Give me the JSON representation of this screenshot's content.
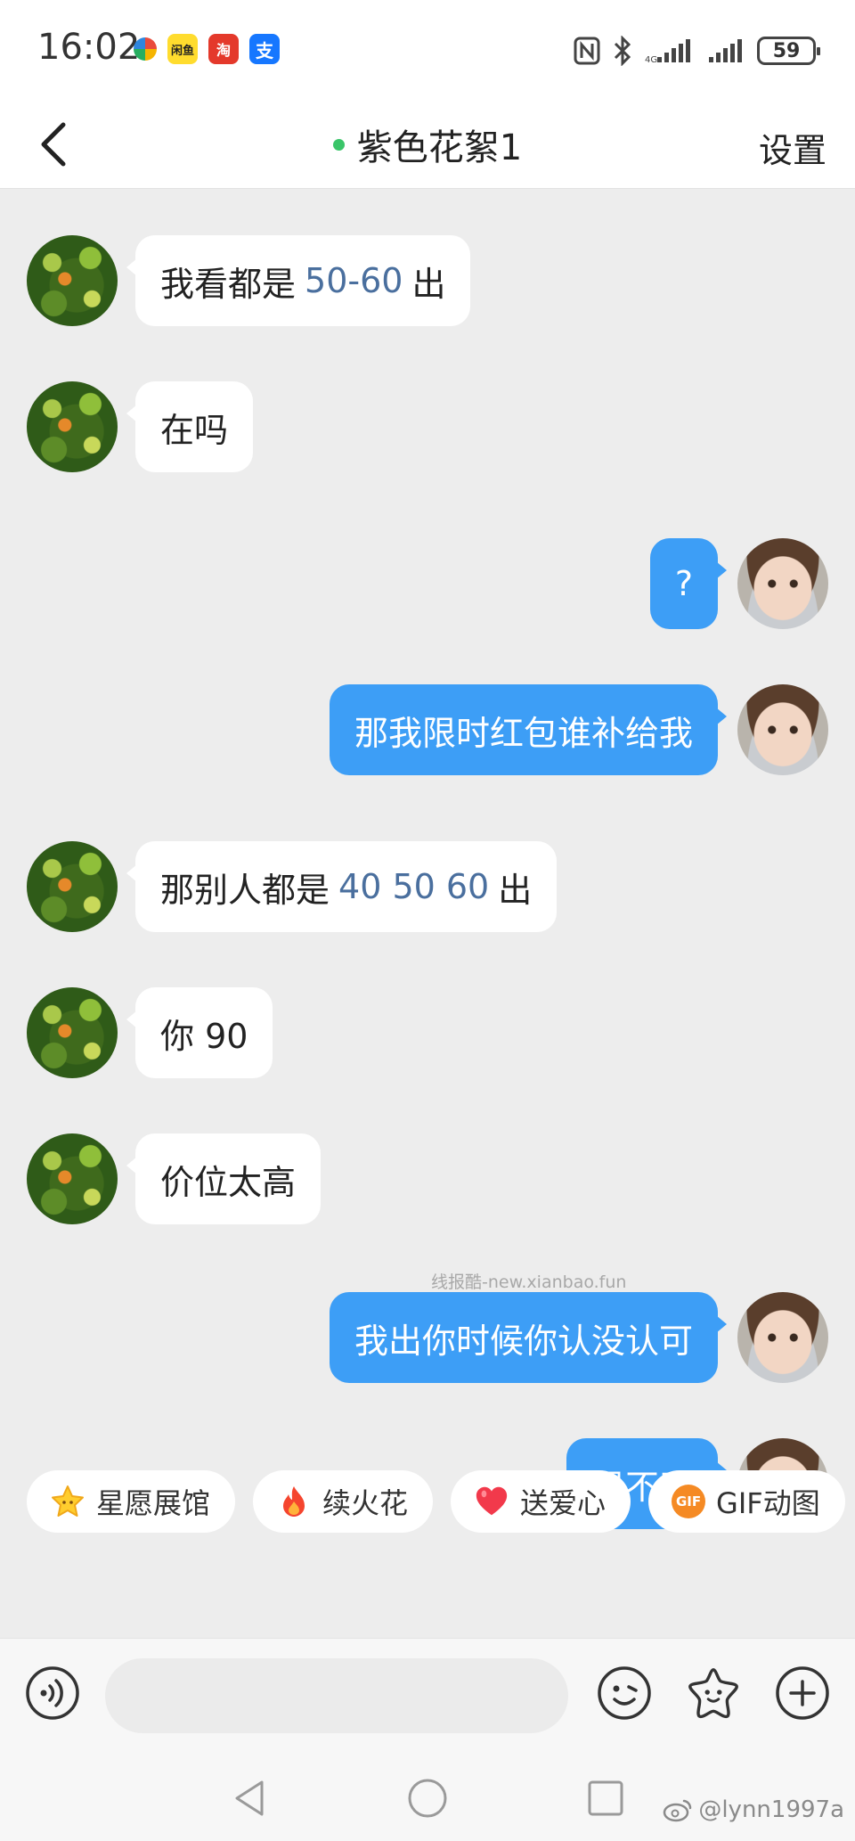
{
  "status_bar": {
    "time": "16:02",
    "app_icons": [
      {
        "name": "pinwheel-app-icon",
        "glyph": ""
      },
      {
        "name": "xianyu-app-icon",
        "glyph": "闲鱼"
      },
      {
        "name": "taobao-app-icon",
        "glyph": "淘"
      },
      {
        "name": "alipay-app-icon",
        "glyph": "支"
      }
    ],
    "battery": "59"
  },
  "header": {
    "title": "紫色花絮1",
    "online_color": "#3ac569",
    "settings_label": "设置"
  },
  "messages": [
    {
      "side": "in",
      "segments": [
        {
          "text": "我看都是"
        },
        {
          "text": "50-60",
          "highlight": true
        },
        {
          "text": "出"
        }
      ]
    },
    {
      "side": "in",
      "segments": [
        {
          "text": "在吗"
        }
      ]
    },
    {
      "side": "out",
      "segments": [
        {
          "text": "?"
        }
      ]
    },
    {
      "side": "out",
      "segments": [
        {
          "text": "那我限时红包谁补给我"
        }
      ]
    },
    {
      "side": "in",
      "segments": [
        {
          "text": "那别人都是"
        },
        {
          "text": "40 50 60",
          "highlight": true
        },
        {
          "text": "出"
        }
      ]
    },
    {
      "side": "in",
      "segments": [
        {
          "text": "你 90"
        }
      ]
    },
    {
      "side": "in",
      "segments": [
        {
          "text": "价位太高"
        }
      ]
    },
    {
      "side": "out",
      "segments": [
        {
          "text": "我出你时候你认没认可"
        }
      ]
    },
    {
      "side": "out",
      "segments": [
        {
          "text": "退不了"
        }
      ]
    }
  ],
  "watermark": "线报酷-new.xianbao.fun",
  "quick_actions": [
    {
      "label": "星愿展馆",
      "icon": "star-icon"
    },
    {
      "label": "续火花",
      "icon": "flame-icon"
    },
    {
      "label": "送爱心",
      "icon": "heart-icon"
    },
    {
      "label": "GIF动图",
      "icon": "gif-icon",
      "badge": "GIF"
    }
  ],
  "input": {
    "placeholder": ""
  },
  "weibo_handle": "@lynn1997a",
  "colors": {
    "accent": "#3d9ef6",
    "background": "#ededed",
    "number_highlight": "#4a6f9e"
  }
}
